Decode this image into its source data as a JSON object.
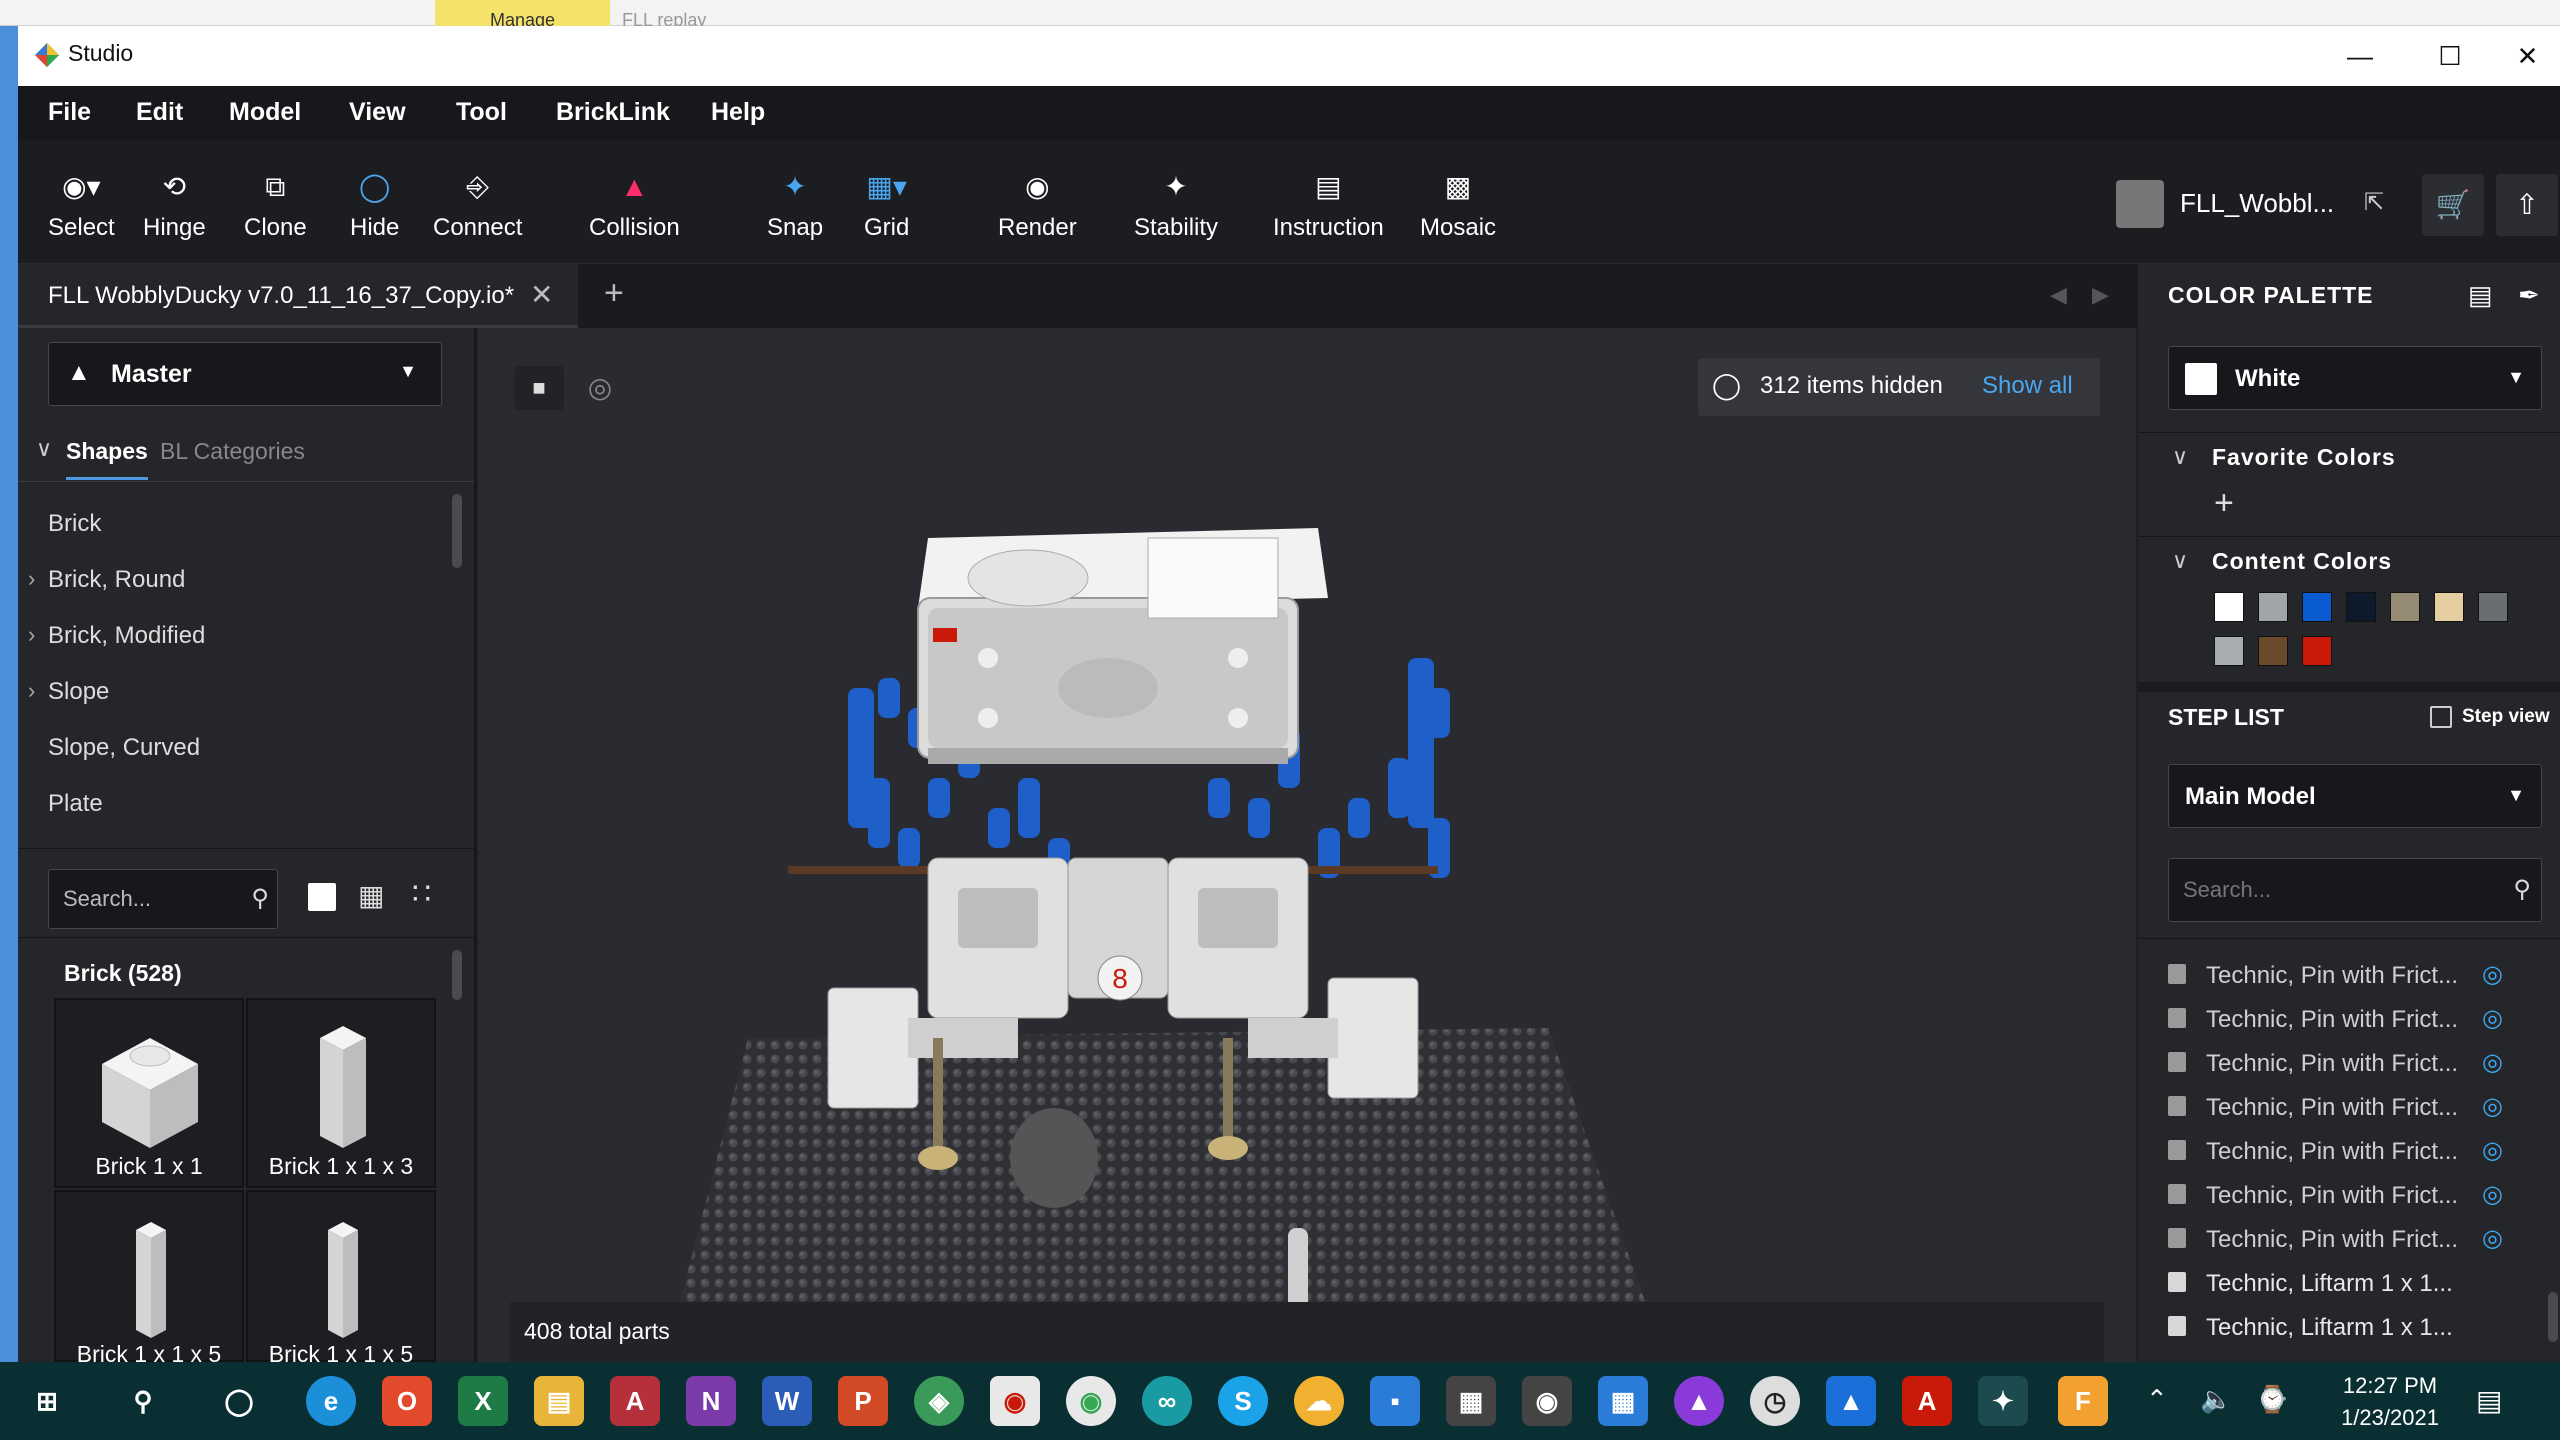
{
  "window": {
    "title": "Studio"
  },
  "background_windows": {
    "tab1": "Manage",
    "tab2": "FLL replay"
  },
  "menu": [
    "File",
    "Edit",
    "Model",
    "View",
    "Tool",
    "BrickLink",
    "Help"
  ],
  "toolbar": {
    "select": "Select",
    "hinge": "Hinge",
    "clone": "Clone",
    "hide": "Hide",
    "connect": "Connect",
    "collision": "Collision",
    "snap": "Snap",
    "grid": "Grid",
    "render": "Render",
    "stability": "Stability",
    "instruction": "Instruction",
    "mosaic": "Mosaic",
    "user": "FLL_Wobbl..."
  },
  "tab": {
    "title": "FLL WobblyDucky v7.0_11_16_37_Copy.io*"
  },
  "left_panel": {
    "master": "Master",
    "tabs": [
      "Shapes",
      "BL Categories"
    ],
    "categories": [
      {
        "label": "Brick",
        "expandable": false
      },
      {
        "label": "Brick, Round",
        "expandable": true
      },
      {
        "label": "Brick, Modified",
        "expandable": true
      },
      {
        "label": "Slope",
        "expandable": true
      },
      {
        "label": "Slope, Curved",
        "expandable": false
      },
      {
        "label": "Plate",
        "expandable": false
      }
    ],
    "search_placeholder": "Search...",
    "group_title": "Brick (528)",
    "parts": [
      "Brick 1 x 1",
      "Brick 1 x 1 x 3",
      "Brick 1 x 1 x 5",
      "Brick 1 x 1 x 5"
    ]
  },
  "viewport": {
    "hidden_count": "312 items hidden",
    "show_all": "Show all",
    "total_parts": "408 total parts"
  },
  "color_palette": {
    "title": "COLOR PALETTE",
    "selected": "White",
    "favorite_title": "Favorite Colors",
    "content_title": "Content Colors",
    "content_colors": [
      "#ffffff",
      "#a0a5a9",
      "#0a5ad0",
      "#0c1a2b",
      "#958a73",
      "#e4cd9e",
      "#6b6e70",
      "#a8adb1",
      "#6b4a2b",
      "#c91a09"
    ]
  },
  "step_list": {
    "title": "STEP LIST",
    "step_view": "Step view",
    "model": "Main Model",
    "search_placeholder": "Search...",
    "items": [
      {
        "label": "Technic, Pin with Frict...",
        "hidden": true
      },
      {
        "label": "Technic, Pin with Frict...",
        "hidden": true
      },
      {
        "label": "Technic, Pin with Frict...",
        "hidden": true
      },
      {
        "label": "Technic, Pin with Frict...",
        "hidden": true
      },
      {
        "label": "Technic, Pin with Frict...",
        "hidden": true
      },
      {
        "label": "Technic, Pin with Frict...",
        "hidden": true
      },
      {
        "label": "Technic, Pin with Frict...",
        "hidden": true
      },
      {
        "label": "Technic, Liftarm 1 x 1...",
        "hidden": false
      },
      {
        "label": "Technic, Liftarm 1 x 1...",
        "hidden": false
      }
    ]
  },
  "taskbar": {
    "time": "12:27 PM",
    "date": "1/23/2021"
  }
}
